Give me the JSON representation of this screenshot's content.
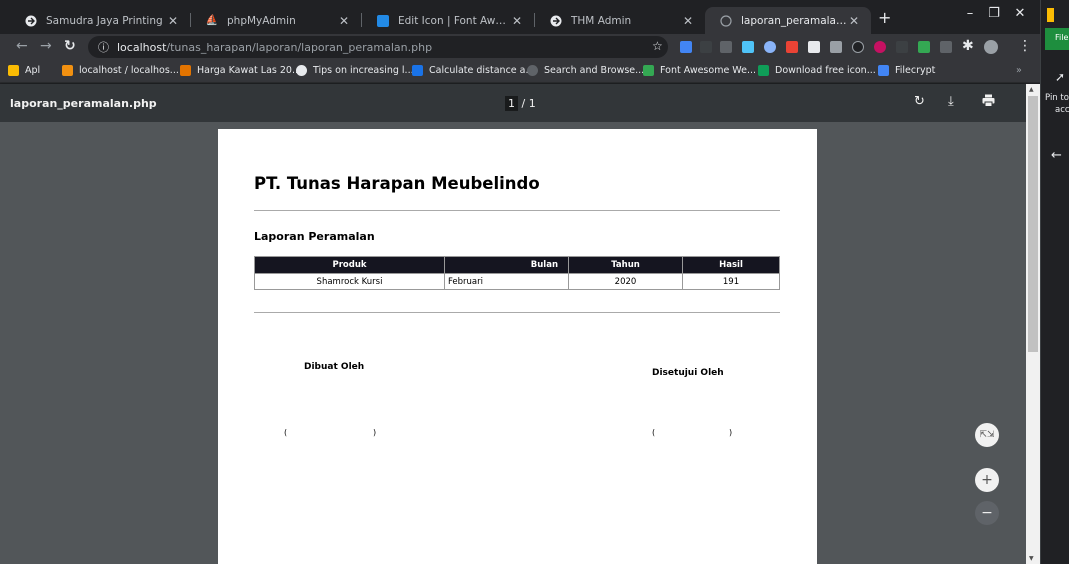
{
  "tabs": [
    {
      "title": "Samudra Jaya Printing",
      "icon": "globe-icon"
    },
    {
      "title": "phpMyAdmin",
      "icon": "phpmyadmin-icon"
    },
    {
      "title": "Edit Icon | Font Awesome",
      "icon": "font-awesome-icon"
    },
    {
      "title": "THM Admin",
      "icon": "globe-icon"
    },
    {
      "title": "laporan_peramalan.php",
      "icon": "globe-icon"
    }
  ],
  "url": {
    "host": "localhost",
    "path": "/tunas_harapan/laporan/laporan_peramalan.php"
  },
  "bookmarks": [
    {
      "label": "Apl"
    },
    {
      "label": "localhost / localhos..."
    },
    {
      "label": "Harga Kawat Las 20..."
    },
    {
      "label": "Tips on increasing l..."
    },
    {
      "label": "Calculate distance a..."
    },
    {
      "label": "Search and Browse..."
    },
    {
      "label": "Font Awesome We..."
    },
    {
      "label": "Download free icon..."
    },
    {
      "label": "Filecrypt"
    }
  ],
  "pdf": {
    "title": "laporan_peramalan.php",
    "page_current": "1",
    "page_total": "/ 1"
  },
  "document": {
    "company": "PT. Tunas Harapan Meubelindo",
    "report_title": "Laporan Peramalan",
    "table": {
      "headers": [
        "Produk",
        "Bulan",
        "Tahun",
        "Hasil"
      ],
      "rows": [
        [
          "Shamrock Kursi",
          "Februari",
          "2020",
          "191"
        ]
      ]
    },
    "made_by": "Dibuat Oleh",
    "approved_by": "Disetujui Oleh",
    "paren_open": "(",
    "paren_close": ")"
  },
  "sidepanel": {
    "file_label": "File",
    "pin_line1": "Pin to",
    "pin_line2": "acc"
  }
}
